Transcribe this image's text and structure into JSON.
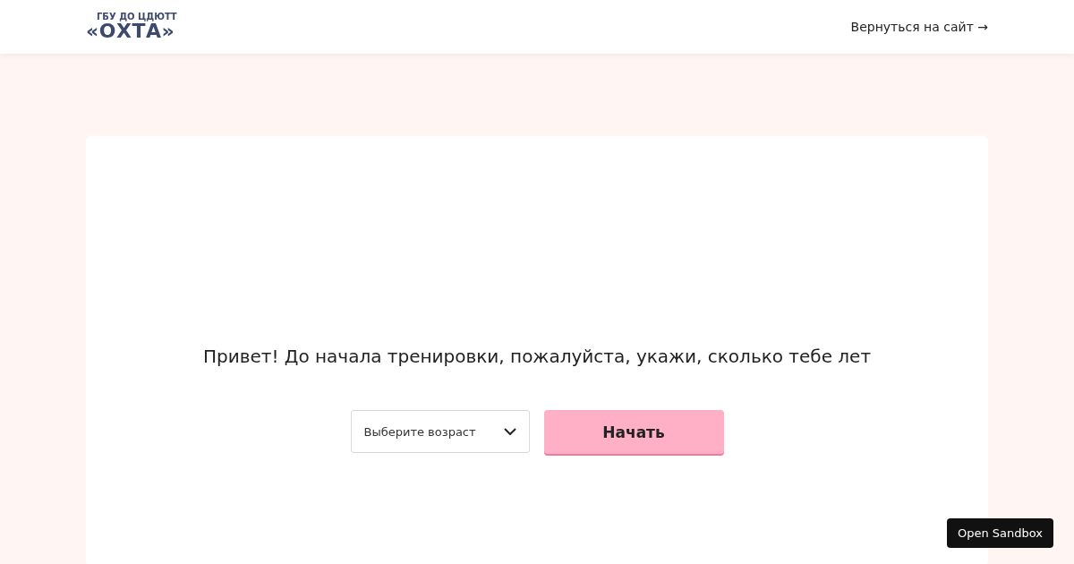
{
  "header": {
    "logo": {
      "top": "ГБУ ДО ЦДЮТТ",
      "name": "«ОХТА»"
    },
    "back_link": "Вернуться на сайт →"
  },
  "card": {
    "heading": "Привет! До начала тренировки, пожалуйста, укажи, сколько тебе лет",
    "age_select": {
      "placeholder": "Выберите возраст"
    },
    "start_button": "Начать"
  },
  "sandbox_button": "Open Sandbox"
}
